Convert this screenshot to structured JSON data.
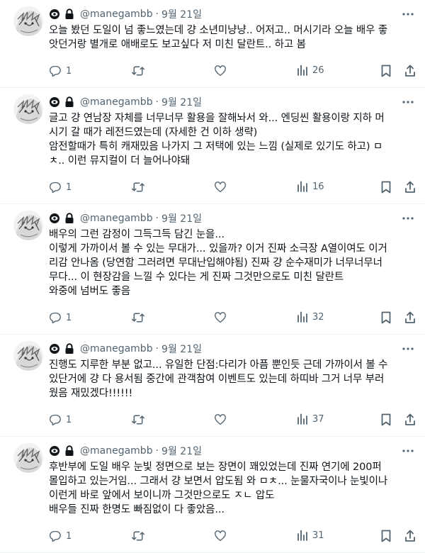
{
  "tweets": [
    {
      "handle": "@manegambb",
      "separator": "·",
      "date": "9월 21일",
      "lines": [
        "오늘 봤던 도일이 넘 좋느였는데 걍 소년미냥냥.. 어저고.. 머시기라 오늘 배우 좋",
        "앗던거랑 별개로 애배로도 보고싶다 저 미친 달란트.. 하고 봄"
      ],
      "reply_count": "1",
      "retweet_count": "",
      "like_count": "",
      "view_count": "26"
    },
    {
      "handle": "@manegambb",
      "separator": "·",
      "date": "9월 21일",
      "lines": [
        "글고 걍 연남장 자체를 너무너무 활용을 잘해놔서 와... 엔딩씬 활용이랑 지하 머",
        "시기 갈 때가 레전드였는데 (자세한 건 이하 생략)",
        "암전할때가 특히 캐재밌음 나가지 그 저택에 있는 느낌 (실제로 있기도 하고) ㅁ",
        "ㅊ.. 이런 뮤지컬이 더 늘어나야돼"
      ],
      "reply_count": "1",
      "retweet_count": "",
      "like_count": "",
      "view_count": "16"
    },
    {
      "handle": "@manegambb",
      "separator": "·",
      "date": "9월 21일",
      "lines": [
        "배우의 그런 감정이 그득그득 담긴 눈을...",
        "이렇게 가까이서 볼 수 있는 무대가... 있을까? 이거 진짜 소극장 A열이여도 이거",
        "리감 안나옴 (당연함 그러려면 무대난입해야됨) 진짜 걍 순수재미가 너무너무너",
        "무다... 이 현장감을 느낄 수 있다는 게 진짜 그것만으로도 미친 달란트",
        "와중에 넘버도 좋음"
      ],
      "reply_count": "1",
      "retweet_count": "",
      "like_count": "",
      "view_count": "32"
    },
    {
      "handle": "@manegambb",
      "separator": "·",
      "date": "9월 21일",
      "lines": [
        "진행도 지루한 부분 없고... 유일한 단점:다리가 아픔 뿐인듯 근데 가까이서 볼 수",
        "있단거에 걍 다 용서됨 중간에 관객참여 이벤트도 있는데 하띠바 그거 너무 부러",
        "웠음 재밌겠다!!!!!!"
      ],
      "reply_count": "1",
      "retweet_count": "",
      "like_count": "",
      "view_count": "37"
    },
    {
      "handle": "@manegambb",
      "separator": "·",
      "date": "9월 21일",
      "lines": [
        "후반부에 도일 배우 눈빛 정면으로 보는 장면이 꽤있었는데 진짜 연기에 200퍼",
        "몰입하고 있는거임... 그래서 걍 보면서 압도됨 와 ㅁㅊ... 눈물자국이나 눈빛이나",
        "이런게 바로 앞에서 보이니까 그것만으로도 ㅈㄴ 압도",
        "배우들 진짜 한명도 빠짐없이 다 좋았음..."
      ],
      "reply_count": "1",
      "retweet_count": "",
      "like_count": "",
      "view_count": "31"
    }
  ]
}
